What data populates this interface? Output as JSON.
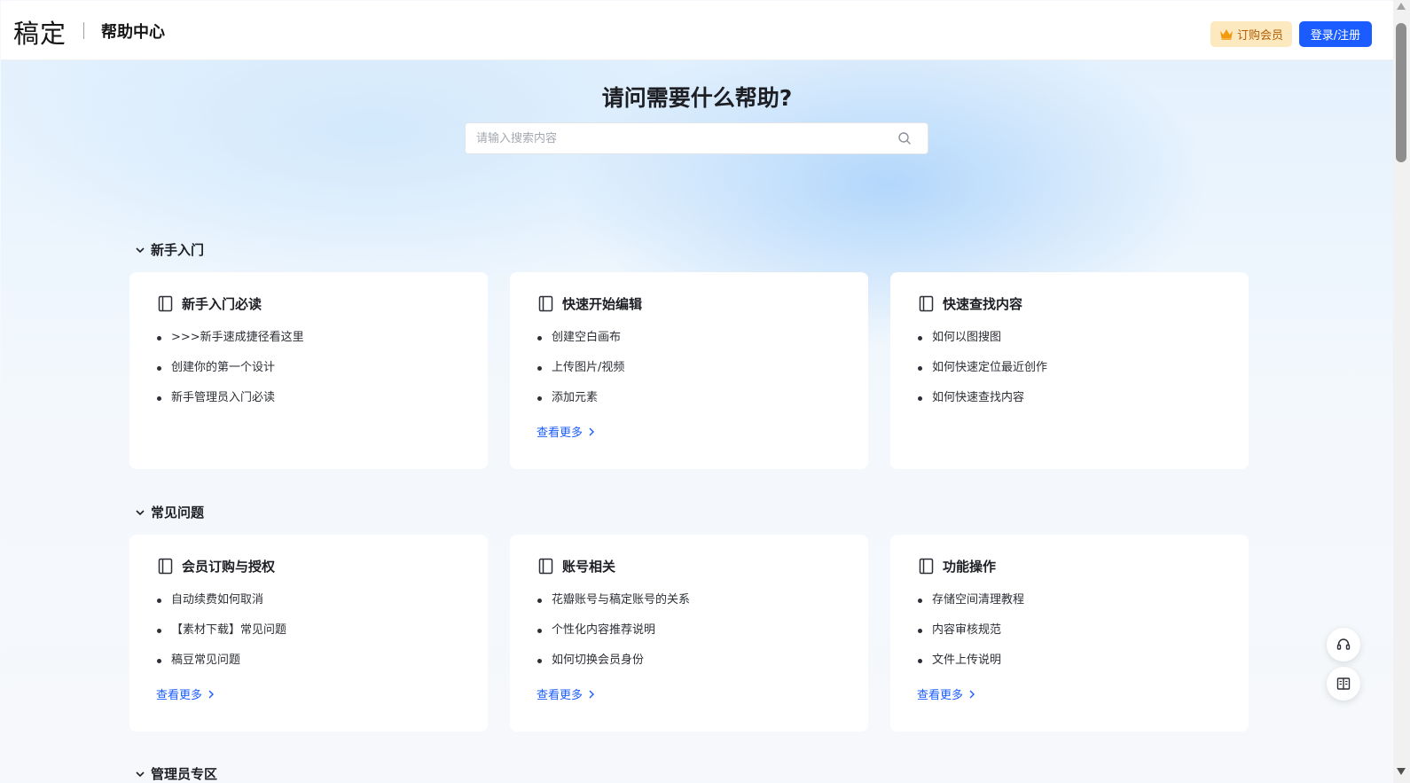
{
  "header": {
    "logo": "稿定",
    "title": "帮助中心",
    "member_button": "订购会员",
    "login_button": "登录/注册"
  },
  "hero": {
    "title": "请问需要什么帮助?",
    "search_placeholder": "请输入搜索内容"
  },
  "sections": [
    {
      "title": "新手入门",
      "cards": [
        {
          "title": "新手入门必读",
          "items": [
            ">>>新手速成捷径看这里",
            "创建你的第一个设计",
            "新手管理员入门必读"
          ],
          "more": ""
        },
        {
          "title": "快速开始编辑",
          "items": [
            "创建空白画布",
            "上传图片/视频",
            "添加元素"
          ],
          "more": "查看更多"
        },
        {
          "title": "快速查找内容",
          "items": [
            "如何以图搜图",
            "如何快速定位最近创作",
            "如何快速查找内容"
          ],
          "more": ""
        }
      ]
    },
    {
      "title": "常见问题",
      "cards": [
        {
          "title": "会员订购与授权",
          "items": [
            "自动续费如何取消",
            "【素材下载】常见问题",
            "稿豆常见问题"
          ],
          "more": "查看更多"
        },
        {
          "title": "账号相关",
          "items": [
            "花瓣账号与稿定账号的关系",
            "个性化内容推荐说明",
            "如何切换会员身份"
          ],
          "more": "查看更多"
        },
        {
          "title": "功能操作",
          "items": [
            "存储空间清理教程",
            "内容审核规范",
            "文件上传说明"
          ],
          "more": "查看更多"
        }
      ]
    },
    {
      "title": "管理员专区",
      "cards": []
    }
  ],
  "colors": {
    "accent": "#1a5cff",
    "member_bg": "#fde9bf",
    "member_text": "#b25d00"
  },
  "icons": {
    "search": "search-icon",
    "crown": "crown-icon",
    "book": "book-icon",
    "headset": "headset-icon",
    "guide": "book-open-icon"
  }
}
